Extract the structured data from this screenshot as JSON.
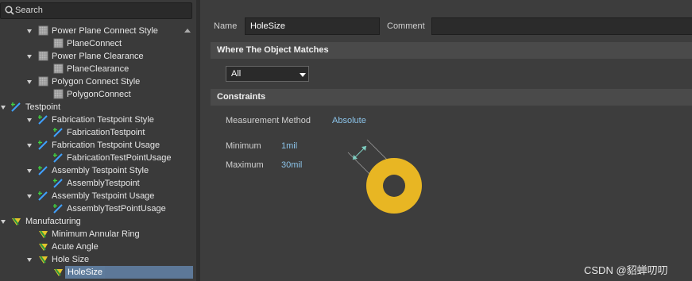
{
  "search": {
    "placeholder": "Search"
  },
  "tree": [
    {
      "label": "Power Plane Connect Style",
      "icon": "plane-rule-icon",
      "level": 2,
      "expanded": true
    },
    {
      "label": "PlaneConnect",
      "icon": "plane-rule-icon",
      "level": 3
    },
    {
      "label": "Power Plane Clearance",
      "icon": "plane-rule-icon",
      "level": 2,
      "expanded": true
    },
    {
      "label": "PlaneClearance",
      "icon": "plane-rule-icon",
      "level": 3
    },
    {
      "label": "Polygon Connect Style",
      "icon": "plane-rule-icon",
      "level": 2,
      "expanded": true
    },
    {
      "label": "PolygonConnect",
      "icon": "plane-rule-icon",
      "level": 3
    },
    {
      "label": "Testpoint",
      "icon": "testpoint-icon",
      "level": 1,
      "expanded": true
    },
    {
      "label": "Fabrication Testpoint Style",
      "icon": "testpoint-icon",
      "level": 2,
      "expanded": true
    },
    {
      "label": "FabricationTestpoint",
      "icon": "testpoint-icon",
      "level": 3
    },
    {
      "label": "Fabrication Testpoint Usage",
      "icon": "testpoint-icon",
      "level": 2,
      "expanded": true
    },
    {
      "label": "FabricationTestPointUsage",
      "icon": "testpoint-icon",
      "level": 3
    },
    {
      "label": "Assembly Testpoint Style",
      "icon": "testpoint-icon",
      "level": 2,
      "expanded": true
    },
    {
      "label": "AssemblyTestpoint",
      "icon": "testpoint-icon",
      "level": 3
    },
    {
      "label": "Assembly Testpoint Usage",
      "icon": "testpoint-icon",
      "level": 2,
      "expanded": true
    },
    {
      "label": "AssemblyTestPointUsage",
      "icon": "testpoint-icon",
      "level": 3
    },
    {
      "label": "Manufacturing",
      "icon": "manufacturing-icon",
      "level": 1,
      "expanded": true
    },
    {
      "label": "Minimum Annular Ring",
      "icon": "manufacturing-icon",
      "level": 2,
      "expanded": false
    },
    {
      "label": "Acute Angle",
      "icon": "manufacturing-icon",
      "level": 2,
      "expanded": false
    },
    {
      "label": "Hole Size",
      "icon": "manufacturing-icon",
      "level": 2,
      "expanded": true
    },
    {
      "label": "HoleSize",
      "icon": "manufacturing-icon",
      "level": 3,
      "selected": true
    }
  ],
  "form": {
    "name_label": "Name",
    "name_value": "HoleSize",
    "comment_label": "Comment",
    "comment_value": "",
    "where_title": "Where The Object Matches",
    "match_value": "All",
    "constraints_title": "Constraints",
    "measurement_label": "Measurement Method",
    "measurement_value": "Absolute",
    "minimum_label": "Minimum",
    "minimum_value": "1mil",
    "maximum_label": "Maximum",
    "maximum_value": "30mil"
  },
  "colors": {
    "pad": "#e8b623",
    "link": "#8cc4ea",
    "selection": "#5d7898"
  },
  "watermark": "CSDN @貂蝉叨叨"
}
